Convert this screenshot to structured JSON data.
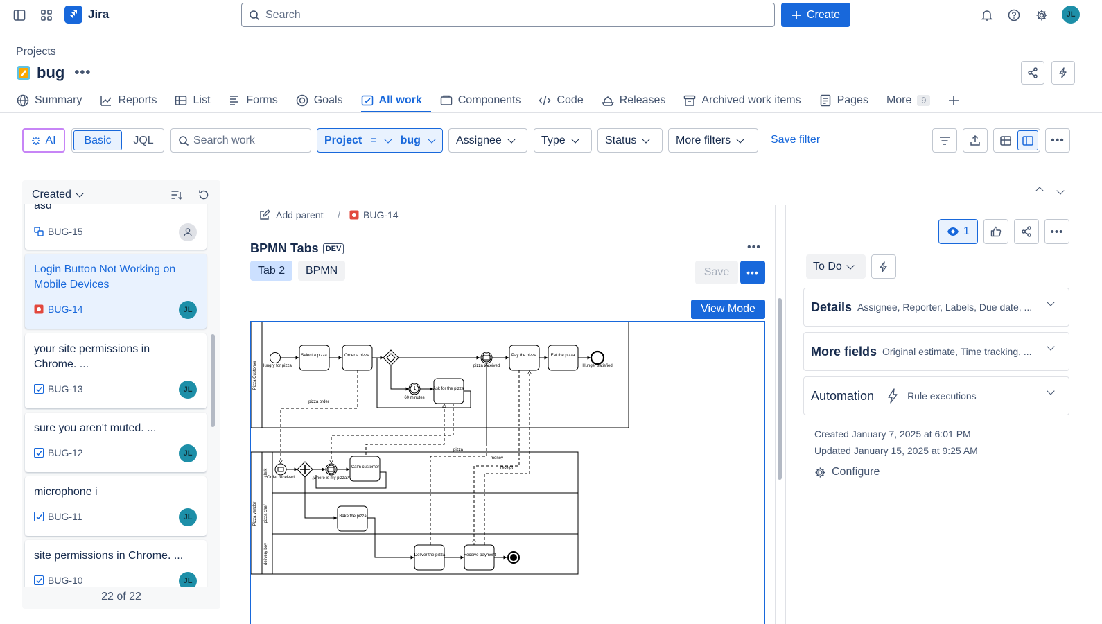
{
  "topbar": {
    "app_name": "Jira",
    "search_placeholder": "Search",
    "create_label": "Create",
    "avatar_initials": "JL"
  },
  "header": {
    "breadcrumb": "Projects",
    "project_name": "bug"
  },
  "tabs": [
    {
      "label": "Summary",
      "icon": "globe-icon"
    },
    {
      "label": "Reports",
      "icon": "chart-icon"
    },
    {
      "label": "List",
      "icon": "list-icon"
    },
    {
      "label": "Forms",
      "icon": "forms-icon"
    },
    {
      "label": "Goals",
      "icon": "target-icon"
    },
    {
      "label": "All work",
      "icon": "all-work-icon",
      "active": true
    },
    {
      "label": "Components",
      "icon": "components-icon"
    },
    {
      "label": "Code",
      "icon": "code-icon"
    },
    {
      "label": "Releases",
      "icon": "releases-icon"
    },
    {
      "label": "Archived work items",
      "icon": "archive-icon"
    },
    {
      "label": "Pages",
      "icon": "pages-icon"
    },
    {
      "label": "More",
      "icon": "more-icon",
      "badge": "9"
    }
  ],
  "filters": {
    "ai_label": "AI",
    "basic_label": "Basic",
    "jql_label": "JQL",
    "search_placeholder": "Search work",
    "project_label": "Project",
    "project_operator": "=",
    "project_value": "bug",
    "assignee_label": "Assignee",
    "type_label": "Type",
    "status_label": "Status",
    "more_filters_label": "More filters",
    "save_filter_label": "Save filter"
  },
  "list": {
    "sort_label": "Created",
    "count_label": "22 of 22",
    "partial_top_text": "asd",
    "items": [
      {
        "title": "",
        "key": "BUG-15",
        "type": "subtask",
        "assignee": ""
      },
      {
        "title": "Login Button Not Working on Mobile Devices",
        "key": "BUG-14",
        "type": "bug",
        "assignee": "JL",
        "selected": true
      },
      {
        "title": "your site permissions in Chrome. ...",
        "key": "BUG-13",
        "type": "task",
        "assignee": "JL"
      },
      {
        "title": "sure you aren't muted. ...",
        "key": "BUG-12",
        "type": "task",
        "assignee": "JL"
      },
      {
        "title": "microphone i",
        "key": "BUG-11",
        "type": "task",
        "assignee": "JL"
      },
      {
        "title": "site permissions in Chrome. ...",
        "key": "BUG-10",
        "type": "task",
        "assignee": "JL"
      }
    ]
  },
  "detail": {
    "add_parent_label": "Add parent",
    "breadcrumb_sep": "/",
    "issue_key": "BUG-14",
    "app_title": "BPMN Tabs",
    "dev_badge": "DEV",
    "tab2_label": "Tab 2",
    "bpmn_label": "BPMN",
    "save_label": "Save",
    "view_mode_label": "View Mode"
  },
  "bpmn": {
    "pool_customer": "Pizza Customer",
    "pool_vendor": "Pizza vendor",
    "lane_clerk": "clerk",
    "lane_chef": "pizza chef",
    "lane_delivery": "delivery boy",
    "ev_hungry": "Hungry for pizza",
    "task_select": "Select a pizza",
    "task_order": "Order a pizza",
    "ev_received": "pizza received",
    "task_pay": "Pay the pizza",
    "task_eat": "Eat the pizza",
    "ev_satisfied": "Hunger satisfied",
    "ev_60": "60 minutes",
    "task_ask": "Ask for the pizza",
    "msg_order": "pizza order",
    "msg_pizza": "pizza",
    "msg_money": "money",
    "msg_receipt": "receipt",
    "ev_order_received": "Order received",
    "ev_where": "„where is my pizza?“",
    "task_calm": "Calm customer",
    "task_bake": "Bake the pizza",
    "task_deliver": "Deliver the pizza",
    "task_receive": "Receive payment"
  },
  "sidebar": {
    "watch_count": "1",
    "status_label": "To Do",
    "details_label": "Details",
    "details_sub": "Assignee, Reporter, Labels, Due date, ...",
    "more_fields_label": "More fields",
    "more_fields_sub": "Original estimate, Time tracking, ...",
    "automation_label": "Automation",
    "automation_sub": "Rule executions",
    "created_text": "Created January 7, 2025 at 6:01 PM",
    "updated_text": "Updated January 15, 2025 at 9:25 AM",
    "configure_label": "Configure"
  },
  "colors": {
    "brand": "#1868db",
    "avatar": "#1d8fa8",
    "bug": "#e2483d"
  }
}
